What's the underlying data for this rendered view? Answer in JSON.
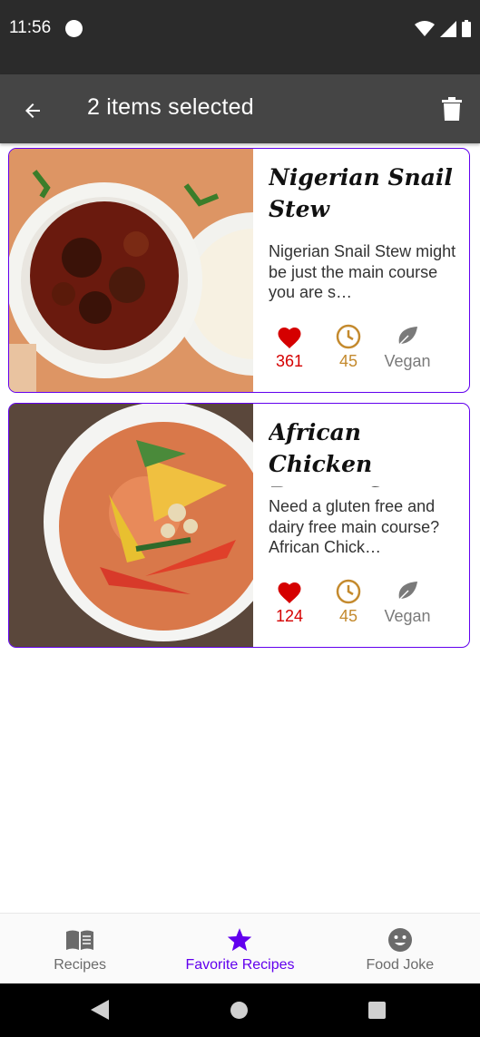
{
  "status_bar": {
    "time": "11:56"
  },
  "app_bar": {
    "title": "2 items selected"
  },
  "recipes": [
    {
      "title": "Nigerian Snail Stew",
      "description": "Nigerian Snail Stew might be just the main course you are s…",
      "likes": "361",
      "minutes": "45",
      "vegan_label": "Vegan"
    },
    {
      "title": "African Chicken Peanut Stew",
      "description": "Need a gluten free and dairy free main course? African Chick…",
      "likes": "124",
      "minutes": "45",
      "vegan_label": "Vegan"
    }
  ],
  "bottom_nav": {
    "items": [
      {
        "label": "Recipes",
        "icon": "menu-book-icon"
      },
      {
        "label": "Favorite Recipes",
        "icon": "star-icon"
      },
      {
        "label": "Food Joke",
        "icon": "smiley-icon"
      }
    ],
    "active_index": 1
  },
  "colors": {
    "accent": "#6200ee",
    "like": "#d50000",
    "time": "#c48a2e",
    "vegan": "#7a7a7a",
    "app_bar": "#454545",
    "status_bar": "#2b2b2b"
  }
}
